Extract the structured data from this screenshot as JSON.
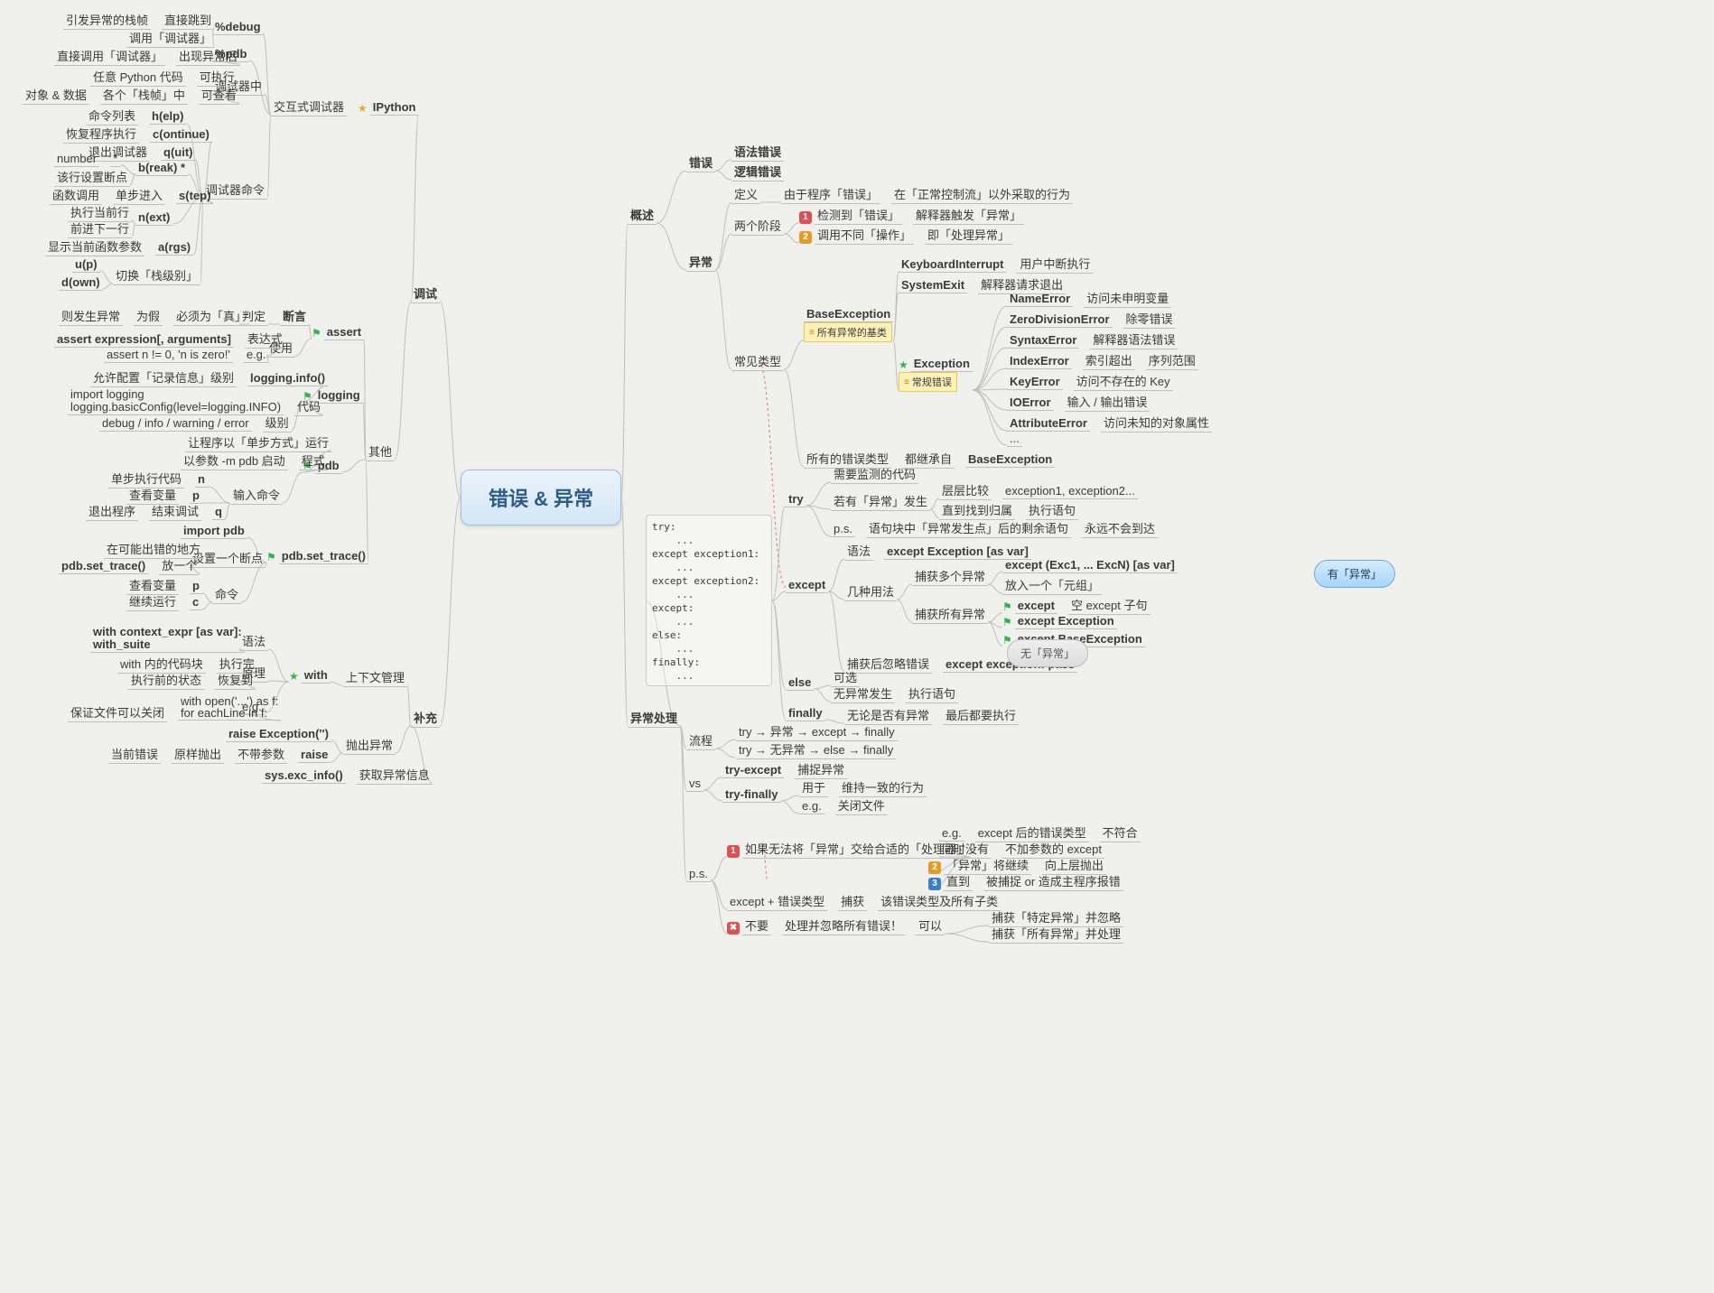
{
  "root": "错误 & 异常",
  "callouts": {
    "has_exc": "有「异常」",
    "no_exc": "无「异常」"
  },
  "right": {
    "b1": {
      "title": "概述",
      "err": {
        "t": "错误",
        "a": "语法错误",
        "b": "逻辑错误"
      },
      "exc": {
        "t": "异常",
        "def": {
          "k": "定义",
          "a": "由于程序「错误」",
          "b": "在「正常控制流」以外采取的行为"
        },
        "stage": {
          "k": "两个阶段",
          "r1a": "检测到「错误」",
          "r1b": "解释器触发「异常」",
          "r2a": "调用不同「操作」",
          "r2b": "即「处理异常」"
        },
        "types": {
          "k": "常见类型",
          "base": {
            "t": "BaseException",
            "note": "所有异常的基类",
            "ki": {
              "t": "KeyboardInterrupt",
              "d": "用户中断执行"
            },
            "se": {
              "t": "SystemExit",
              "d": "解释器请求退出"
            },
            "ex": {
              "t": "Exception",
              "note": "常规错误",
              "ne": {
                "t": "NameError",
                "d": "访问未申明变量"
              },
              "zd": {
                "t": "ZeroDivisionError",
                "d": "除零错误"
              },
              "sy": {
                "t": "SyntaxError",
                "d": "解释器语法错误"
              },
              "ix": {
                "t": "IndexError",
                "d1": "索引超出",
                "d2": "序列范围"
              },
              "ke": {
                "t": "KeyError",
                "d": "访问不存在的 Key"
              },
              "io": {
                "t": "IOError",
                "d": "输入 / 输出错误"
              },
              "ae": {
                "t": "AttributeError",
                "d": "访问未知的对象属性"
              },
              "el": "..."
            }
          },
          "inh": {
            "a": "所有的错误类型",
            "b": "都继承自",
            "c": "BaseException"
          }
        }
      }
    },
    "b2": {
      "title": "异常处理",
      "code": [
        "try:",
        "    ...",
        "except exception1:",
        "    ...",
        "except exception2:",
        "    ...",
        "except:",
        "    ...",
        "else:",
        "    ...",
        "finally:",
        "    ..."
      ],
      "try": {
        "t": "try",
        "a": "需要监测的代码",
        "b": {
          "k": "若有「异常」发生",
          "x": "层层比较",
          "y": "exception1, exception2...",
          "p": "直到找到归属",
          "q": "执行语句"
        },
        "ps": {
          "k": "p.s.",
          "a": "语句块中「异常发生点」后的剩余语句",
          "b": "永远不会到达"
        }
      },
      "exc": {
        "t": "except",
        "syn": {
          "k": "语法",
          "v": "except Exception [as var]"
        },
        "use": {
          "k": "几种用法",
          "multi": {
            "k": "捕获多个异常",
            "a": "except (Exc1, ... ExcN) [as var]",
            "b": "放入一个「元组」"
          },
          "all": {
            "k": "捕获所有异常",
            "a": "except",
            "ad": "空 except 子句",
            "b": "except Exception",
            "c": "except BaseException"
          }
        },
        "ign": {
          "k": "捕获后忽略错误",
          "v": "except exception: pass"
        }
      },
      "els": {
        "t": "else",
        "a": "可选",
        "b": "无异常发生",
        "c": "执行语句"
      },
      "fin": {
        "t": "finally",
        "a": "无论是否有异常",
        "b": "最后都要执行"
      },
      "flow": {
        "t": "流程",
        "a": "try → 异常 → except → finally",
        "b": "try → 无异常 → else → finally"
      },
      "vs": {
        "t": "vs",
        "te": {
          "t": "try-except",
          "d": "捕捉异常"
        },
        "tf": {
          "t": "try-finally",
          "a": "用于",
          "b": "维持一致的行为",
          "c": "e.g.",
          "d": "关闭文件"
        }
      },
      "ps": {
        "t": "p.s.",
        "r1": {
          "h": "如果无法将「异常」交给合适的「处理器」",
          "a1": "e.g.",
          "a2": "except 后的错误类型",
          "a3": "不符合",
          "b1": "同时没有",
          "b2": "不加参数的 except",
          "c1": "「异常」将继续",
          "c2": "向上层抛出",
          "d1": "直到",
          "d2": "被捕捉 or 造成主程序报错"
        },
        "r2": {
          "a": "except + 错误类型",
          "b": "捕获",
          "c": "该错误类型及所有子类"
        },
        "r3": {
          "h": "不要",
          "a": "处理并忽略所有错误！",
          "b": "可以",
          "c1": "捕获「特定异常」并忽略",
          "c2": "捕获「所有异常」并处理"
        }
      }
    }
  },
  "left": {
    "b1": {
      "title": "调试",
      "ia": {
        "t": "交互式调试器",
        "v": "IPython",
        "dbg": {
          "k": "%debug",
          "a1": "引发异常的栈帧",
          "a2": "直接跳到",
          "b": "调用「调试器」"
        },
        "pdb": {
          "k": "%pdb",
          "a1": "直接调用「调试器」",
          "a2": "出现异常后"
        },
        "mid": {
          "k": "调试器中",
          "a1": "任意 Python 代码",
          "a2": "可执行",
          "b1": "对象 & 数据",
          "b2": "各个「栈帧」中",
          "b3": "可查看"
        },
        "cmd": {
          "k": "调试器命令",
          "h": {
            "c": "h(elp)",
            "d": "命令列表"
          },
          "c": {
            "c": "c(ontinue)",
            "d": "恢复程序执行"
          },
          "q": {
            "c": "q(uit)",
            "d": "退出调试器"
          },
          "b": {
            "c": "b(reak) *",
            "d1": "number",
            "d2": "*",
            "d3": "该行设置断点"
          },
          "s": {
            "c": "s(tep)",
            "d1": "函数调用",
            "d2": "单步进入"
          },
          "n": {
            "c": "n(ext)",
            "d1": "执行当前行",
            "d2": "前进下一行"
          },
          "a": {
            "c": "a(rgs)",
            "d": "显示当前函数参数"
          },
          "ud": {
            "u": "u(p)",
            "d": "d(own)",
            "k": "切换「栈级别」"
          }
        }
      },
      "other": {
        "t": "其他",
        "as": {
          "t": "assert",
          "k": "断言",
          "j": {
            "k": "判定",
            "a": "必须为「真」",
            "b": "为假",
            "c": "则发生异常"
          },
          "use": {
            "k": "使用",
            "ex": {
              "k": "表达式",
              "v": "assert expression[, arguments]"
            },
            "eg": {
              "k": "e.g.",
              "v": "assert n != 0, 'n is zero!'"
            }
          }
        },
        "lg": {
          "t": "logging",
          "a": {
            "k": "logging.info()",
            "d": "允许配置「记录信息」级别"
          },
          "b": {
            "k": "代码",
            "v1": "import logging",
            "v2": "logging.basicConfig(level=logging.INFO)"
          },
          "c": {
            "k": "级别",
            "v": "debug / info / warning / error"
          }
        },
        "pd": {
          "t": "pdb",
          "a": "让程序以「单步方式」运行",
          "b": {
            "k": "程式",
            "v": "以参数 -m pdb 启动"
          },
          "c": {
            "k": "输入命令",
            "n": {
              "c": "n",
              "d": "单步执行代码"
            },
            "p": {
              "c": "p",
              "d": "查看变量"
            },
            "q": {
              "c": "q",
              "d1": "退出程序",
              "d2": "结束调试"
            }
          }
        },
        "st": {
          "t": "pdb.set_trace()",
          "a": "import pdb",
          "b": {
            "k": "设置一个断点",
            "x": "在可能出错的地方",
            "y": "pdb.set_trace()",
            "z": "放一个"
          },
          "c": {
            "k": "命令",
            "p": {
              "c": "p",
              "d": "查看变量"
            },
            "cc": {
              "c": "c",
              "d": "继续运行"
            }
          }
        }
      }
    },
    "b2": {
      "title": "补充",
      "ctx": {
        "t": "上下文管理",
        "w": "with",
        "syn": {
          "k": "语法",
          "a": "with context_expr [as var]:",
          "b": "    with_suite"
        },
        "pri": {
          "k": "原理",
          "a1": "with 内的代码块",
          "a2": "执行完",
          "b1": "执行前的状态",
          "b2": "恢复到"
        },
        "eg": {
          "k": "e.g.",
          "a": "保证文件可以关闭",
          "b1": "with open('...') as f:",
          "b2": "    for eachLine in f:"
        }
      },
      "thr": {
        "t": "抛出异常",
        "a": "raise Exception('')",
        "b": {
          "k": "raise",
          "x": "不带参数",
          "y": "原样抛出",
          "z": "当前错误"
        }
      },
      "exi": {
        "t": "获取异常信息",
        "v": "sys.exc_info()"
      }
    }
  }
}
